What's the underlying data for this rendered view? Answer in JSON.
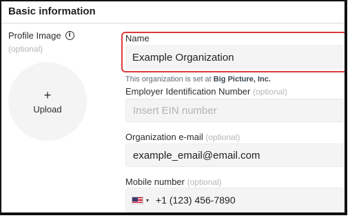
{
  "section": {
    "title": "Basic information"
  },
  "profile": {
    "label": "Profile Image",
    "info_icon": "info-icon",
    "optional": "(optional)",
    "upload_plus": "+",
    "upload_label": "Upload"
  },
  "name_field": {
    "label": "Name",
    "value": "Example Organization",
    "note_prefix": "This organization is set at ",
    "note_org": "Big Picture, Inc.",
    "highlight_color": "#d93a3a"
  },
  "ein_field": {
    "label": "Employer Identification Number",
    "optional": "(optional)",
    "placeholder": "Insert EIN number"
  },
  "email_field": {
    "label": "Organization e-mail",
    "optional": "(optional)",
    "value": "example_email@email.com"
  },
  "mobile_field": {
    "label": "Mobile number",
    "optional": "(optional)",
    "country_icon": "us-flag-icon",
    "caret": "▾",
    "value": "+1 (123) 456-7890"
  }
}
